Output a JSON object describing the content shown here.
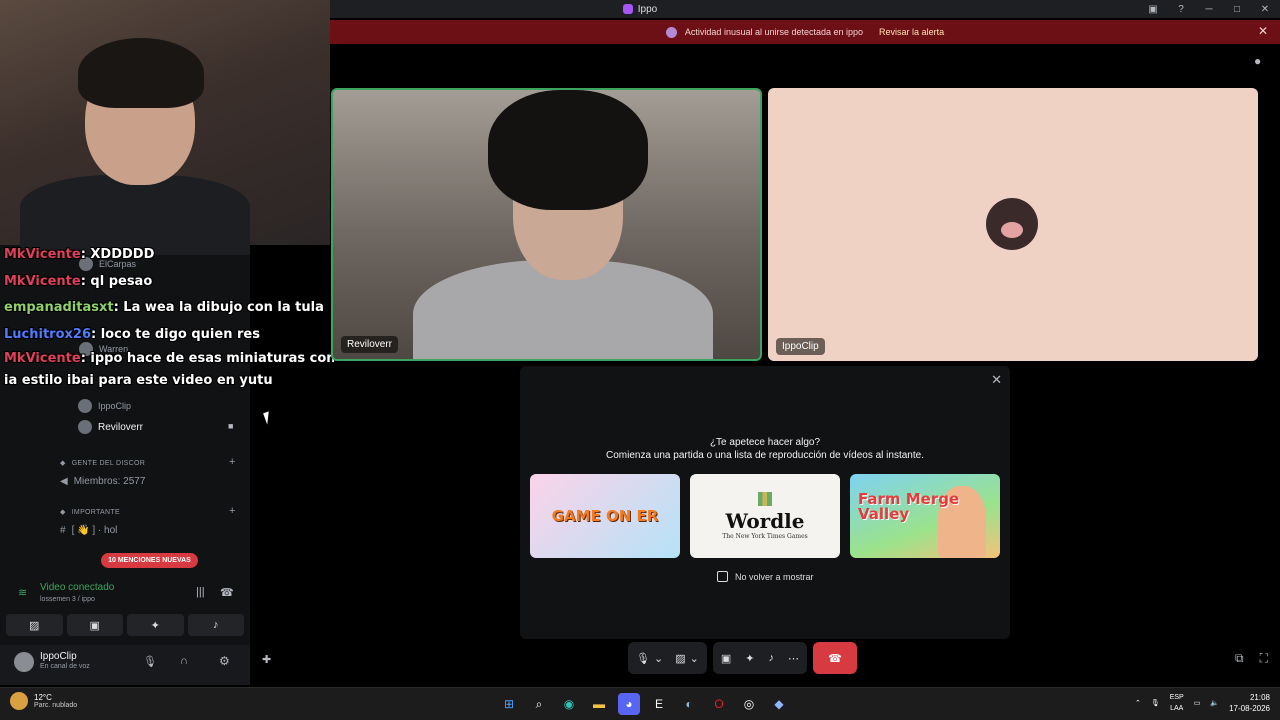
{
  "window": {
    "title": "Ippo"
  },
  "alert": {
    "text": "Actividad inusual al unirse detectada en ippo",
    "action": "Revisar la alerta"
  },
  "chat": [
    {
      "user": "MkVicente",
      "color": "#e0405a",
      "text": ": XDDDDD"
    },
    {
      "user": "MkVicente",
      "color": "#e0405a",
      "text": ": ql pesao"
    },
    {
      "user": "empanaditasxt",
      "color": "#8fd16b",
      "text": ": La wea la dibujo con la tula"
    },
    {
      "user": "Luchitrox26",
      "color": "#4f7cff",
      "text": ": loco te digo quien res"
    },
    {
      "user": "MkVicente",
      "color": "#e0405a",
      "text": ": ippo hace de esas miniaturas con"
    },
    {
      "user": "",
      "color": "#ffffff",
      "text": "ia estilo ibai para este video en yutu"
    }
  ],
  "sidebar": {
    "voice_members": [
      "ElCarpas",
      "Warren"
    ],
    "members": [
      {
        "name": "IppoClip",
        "active": false
      },
      {
        "name": "Reviloverr",
        "active": true
      }
    ],
    "category_1": "GENTE DEL DISCOR",
    "member_count": "Miembros: 2577",
    "category_2": "IMPORTANTE",
    "channel_1": "[ 👋 ] · hol",
    "mentions_badge": "10 MENCIONES NUEVAS"
  },
  "voice_panel": {
    "status": "Video conectado",
    "channel": "lossemen 3 / ippo"
  },
  "user_panel": {
    "name": "IppoClip",
    "status": "En canal de voz"
  },
  "tiles": [
    {
      "name": "Reviloverr"
    },
    {
      "name": "IppoClip"
    }
  ],
  "activity": {
    "title": "¿Te apetece hacer algo?",
    "subtitle": "Comienza una partida o una lista de reproducción de vídeos al instante.",
    "cards": [
      "GAME ON ER",
      "Wordle",
      "Farm Merge Valley"
    ],
    "wordle_sub": "The New York Times Games",
    "checkbox_label": "No volver a mostrar"
  },
  "taskbar": {
    "temp": "12°C",
    "weather": "Parc. nublado",
    "lang_1": "ESP",
    "lang_2": "LAA",
    "time": "21:08",
    "date": "17-08-2026"
  },
  "colors": {
    "accent_red": "#d83a42",
    "connected_green": "#3ba55d",
    "alert_bg": "#6d1016"
  },
  "icons": [
    "inbox-icon",
    "help-icon",
    "minimize-icon",
    "maximize-icon",
    "close-icon",
    "mic-icon",
    "camera-off-icon",
    "screen-share-icon",
    "activities-icon",
    "soundboard-icon",
    "more-icon",
    "hangup-icon",
    "popout-icon",
    "fullscreen-icon",
    "settings-icon",
    "headphones-icon"
  ]
}
